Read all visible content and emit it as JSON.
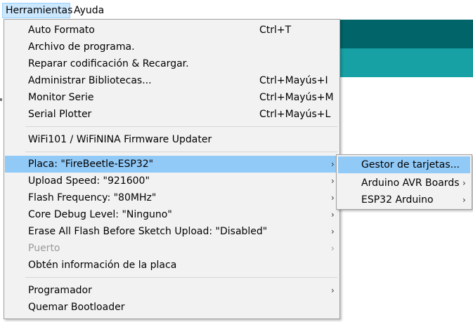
{
  "menubar": {
    "items": [
      {
        "label": "Herramientas"
      },
      {
        "label": "Ayuda"
      }
    ]
  },
  "menu": {
    "items": [
      {
        "label": "Auto Formato",
        "shortcut": "Ctrl+T"
      },
      {
        "label": "Archivo de programa.",
        "shortcut": ""
      },
      {
        "label": "Reparar codificación & Recargar.",
        "shortcut": ""
      },
      {
        "label": "Administrar Bibliotecas...",
        "shortcut": "Ctrl+Mayús+I"
      },
      {
        "label": "Monitor Serie",
        "shortcut": "Ctrl+Mayús+M"
      },
      {
        "label": "Serial Plotter",
        "shortcut": "Ctrl+Mayús+L"
      },
      {
        "label": "WiFi101 / WiFiNINA Firmware Updater",
        "shortcut": ""
      },
      {
        "label": "Placa: \"FireBeetle-ESP32\"",
        "submenu": true,
        "highlighted": true
      },
      {
        "label": "Upload Speed: \"921600\"",
        "submenu": true
      },
      {
        "label": "Flash Frequency: \"80MHz\"",
        "submenu": true
      },
      {
        "label": "Core Debug Level: \"Ninguno\"",
        "submenu": true
      },
      {
        "label": "Erase All Flash Before Sketch Upload: \"Disabled\"",
        "submenu": true
      },
      {
        "label": "Puerto",
        "submenu": true,
        "disabled": true
      },
      {
        "label": "Obtén información de la placa",
        "shortcut": ""
      },
      {
        "label": "Programador",
        "submenu": true
      },
      {
        "label": "Quemar Bootloader",
        "shortcut": ""
      }
    ],
    "arrow": "›"
  },
  "submenu": {
    "items": [
      {
        "label": "Gestor de tarjetas...",
        "highlighted": true
      },
      {
        "label": "Arduino AVR Boards",
        "submenu": true
      },
      {
        "label": "ESP32 Arduino",
        "submenu": true
      }
    ]
  },
  "colors": {
    "highlight": "#91c9f7",
    "menu_bg": "#f2f2f2",
    "app_header_dark": "#006468",
    "app_header_light": "#17a1a5"
  }
}
